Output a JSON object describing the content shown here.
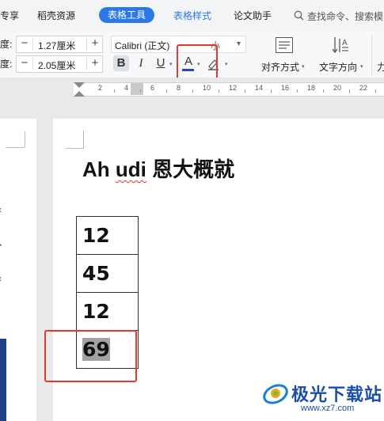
{
  "tabs": [
    {
      "label": "专享",
      "active": false
    },
    {
      "label": "稻壳资源",
      "active": false
    },
    {
      "label": "表格工具",
      "active": true
    },
    {
      "label": "表格样式",
      "active": false
    },
    {
      "label": "论文助手",
      "active": false
    }
  ],
  "search": {
    "placeholder": "查找命令、搜索模"
  },
  "ribbon": {
    "height_label": "度:",
    "height_value": "1.27厘米",
    "width_label": "度:",
    "width_value": "2.05厘米",
    "minus": "−",
    "plus": "+",
    "font_name": "Calibri (正文)",
    "font_size": "小",
    "bold": "B",
    "italic": "I",
    "underline": "U",
    "font_color": "A",
    "align_label": "对齐方式",
    "direction_label": "文字方向",
    "more_label": "力",
    "dropdown_arrow": "▾",
    "font_color_bar": "#2b3fd6"
  },
  "ruler": {
    "ticks": [
      "2",
      "4",
      "6",
      "8",
      "10",
      "12",
      "14",
      "16",
      "18",
      "20",
      "22",
      "24"
    ]
  },
  "left_page_chars": [
    "‹",
    "、",
    "‹"
  ],
  "document": {
    "title_part1": "Ah ",
    "title_part2": "udi",
    "title_part3": " 恩大概就",
    "table_values": [
      "12",
      "45",
      "12",
      "69"
    ]
  },
  "watermark": {
    "name": "极光下载站",
    "url": "www.xz7.com"
  },
  "colors": {
    "accent": "#2b79e6",
    "highlight_box": "#e8352d",
    "selection": "#a3a3a3"
  }
}
